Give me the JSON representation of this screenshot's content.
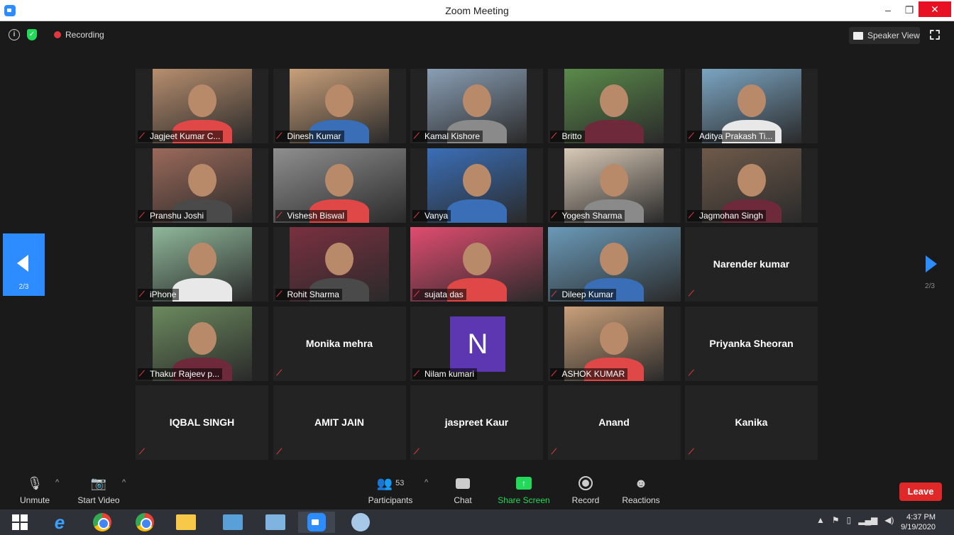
{
  "window": {
    "title": "Zoom Meeting",
    "minimize": "–",
    "maximize": "❐",
    "close": "✕"
  },
  "top": {
    "recording": "Recording",
    "view_label": "Speaker View"
  },
  "pager": {
    "prev_page": "2/3",
    "next_page": "2/3"
  },
  "participants": [
    {
      "name": "Jagjeet Kumar C...",
      "video": true
    },
    {
      "name": "Dinesh Kumar",
      "video": true
    },
    {
      "name": "Kamal Kishore",
      "video": true
    },
    {
      "name": "Britto",
      "video": true
    },
    {
      "name": "Aditya Prakash Ti...",
      "video": true
    },
    {
      "name": "Pranshu Joshi",
      "video": true
    },
    {
      "name": "Vishesh Biswal",
      "video": true
    },
    {
      "name": "Vanya",
      "video": true
    },
    {
      "name": "Yogesh Sharma",
      "video": true
    },
    {
      "name": "Jagmohan Singh",
      "video": true
    },
    {
      "name": "iPhone",
      "video": true
    },
    {
      "name": "Rohit Sharma",
      "video": true
    },
    {
      "name": "sujata das",
      "video": true
    },
    {
      "name": "Dileep Kumar",
      "video": true
    },
    {
      "name": "Narender kumar",
      "video": false
    },
    {
      "name": "Thakur Rajeev p...",
      "video": true
    },
    {
      "name": "Monika mehra",
      "video": false
    },
    {
      "name": "Nilam kumari",
      "video": false,
      "initial": "N"
    },
    {
      "name": "ASHOK KUMAR",
      "video": true
    },
    {
      "name": "Priyanka Sheoran",
      "video": false
    },
    {
      "name": "IQBAL SINGH",
      "video": false
    },
    {
      "name": "AMIT JAIN",
      "video": false
    },
    {
      "name": "jaspreet Kaur",
      "video": false
    },
    {
      "name": "Anand",
      "video": false
    },
    {
      "name": "Kanika",
      "video": false
    }
  ],
  "toolbar": {
    "unmute": "Unmute",
    "start_video": "Start Video",
    "participants_count": "53",
    "participants": "Participants",
    "chat": "Chat",
    "share_screen": "Share Screen",
    "record": "Record",
    "reactions": "Reactions",
    "leave": "Leave"
  },
  "taskbar": {
    "time": "4:37 PM",
    "date": "9/19/2020"
  },
  "colors": {
    "accent": "#2d8cff",
    "leave": "#e02828",
    "share": "#23d959",
    "muted": "#e0383e"
  }
}
